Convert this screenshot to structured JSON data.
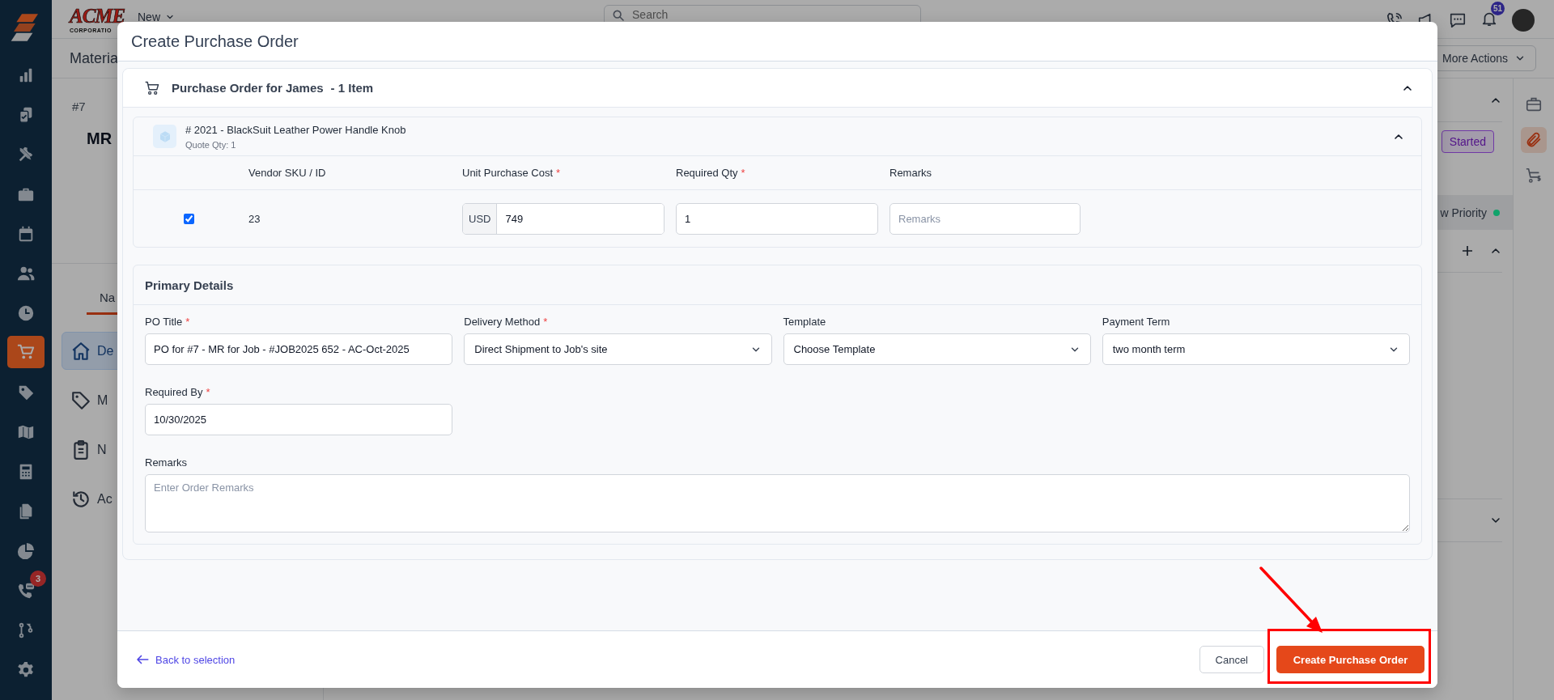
{
  "sidebar": {
    "items": [
      {
        "selected": false
      },
      {
        "selected": false
      },
      {
        "selected": false
      },
      {
        "selected": false
      },
      {
        "selected": false
      },
      {
        "selected": false
      },
      {
        "selected": false
      },
      {
        "selected": true
      },
      {
        "selected": false
      },
      {
        "selected": false
      },
      {
        "selected": false
      },
      {
        "selected": false
      },
      {
        "selected": false
      },
      {
        "selected": false,
        "badge": "3"
      },
      {
        "selected": false
      },
      {
        "selected": false
      }
    ]
  },
  "topbar": {
    "logo": {
      "name": "ACME",
      "tagline": "CORPORATIO"
    },
    "new_menu": "New",
    "search": {
      "placeholder": "Search"
    },
    "notifications": "51"
  },
  "page": {
    "title": "Materia",
    "more_actions": "More Actions",
    "record_number": "#7",
    "record_title": "MR",
    "tab": "Na",
    "nav": [
      {
        "label": "De",
        "selected": true
      },
      {
        "label": "M",
        "selected": false
      },
      {
        "label": "N",
        "selected": false
      },
      {
        "label": "Ac",
        "selected": false
      }
    ],
    "status": "Started",
    "priority": {
      "label": "w Priority",
      "color": "#10a36b"
    },
    "rail": [
      {
        "selected": false
      },
      {
        "selected": true
      },
      {
        "selected": false
      }
    ]
  },
  "modal": {
    "title": "Create Purchase Order",
    "vendor_group": {
      "title": "Purchase Order for James",
      "count": "- 1 Item",
      "expanded": true
    },
    "item": {
      "title": "# 2021 - BlackSuit Leather Power Handle Knob",
      "quote_qty": "Quote Qty: 1",
      "expanded": true,
      "columns": [
        {
          "label": "Vendor SKU / ID"
        },
        {
          "label": "Unit Purchase Cost",
          "required_mark": "*"
        },
        {
          "label": "Required Qty",
          "required_mark": "*"
        },
        {
          "label": "Remarks"
        }
      ],
      "row": {
        "checked": true,
        "sku": "23",
        "currency": "USD",
        "unit_cost": "749",
        "qty": "1",
        "remarks_placeholder": "Remarks"
      }
    },
    "primary": {
      "title": "Primary Details",
      "fields": [
        {
          "kind": "text",
          "label": "PO Title",
          "required_mark": "*",
          "value": "PO for #7 - MR for Job - #JOB2025 652 - AC-Oct-2025"
        },
        {
          "kind": "select",
          "label": "Delivery Method",
          "required_mark": "*",
          "value": "Direct Shipment to Job's site"
        },
        {
          "kind": "select",
          "label": "Template",
          "value": "Choose Template"
        },
        {
          "kind": "select",
          "label": "Payment Term",
          "value": "two month term"
        },
        {
          "kind": "text",
          "label": "Required By",
          "required_mark": "*",
          "value": "10/30/2025"
        },
        {
          "kind": "textarea",
          "label": "Remarks",
          "placeholder": "Enter Order Remarks"
        }
      ]
    },
    "footer": {
      "back": "Back to selection",
      "cancel": "Cancel",
      "submit": "Create Purchase Order"
    }
  }
}
